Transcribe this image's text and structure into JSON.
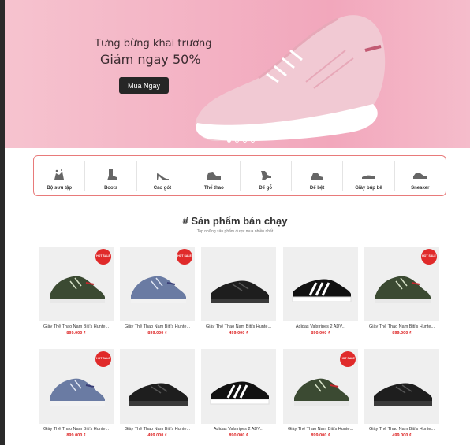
{
  "banner": {
    "line1": "Tưng bừng khai trương",
    "line2": "Giảm ngay 50%",
    "button": "Mua Ngay",
    "slides": 4,
    "active_slide": 1
  },
  "categories": [
    {
      "label": "Bộ sưu tập",
      "icon": "collection-icon"
    },
    {
      "label": "Boots",
      "icon": "boot-icon"
    },
    {
      "label": "Cao gót",
      "icon": "high-heel-icon"
    },
    {
      "label": "Thể thao",
      "icon": "sneaker-icon"
    },
    {
      "label": "Đế gỗ",
      "icon": "wooden-sole-icon"
    },
    {
      "label": "Đế bệt",
      "icon": "flat-shoe-icon"
    },
    {
      "label": "Giày búp bê",
      "icon": "ballet-flat-icon"
    },
    {
      "label": "Sneaker",
      "icon": "sneaker-icon"
    }
  ],
  "section": {
    "title": "# Sản phẩm bán chạy",
    "subtitle": "Top những sản phẩm được mua nhiều nhất"
  },
  "products": [
    {
      "name": "Giày Thể Thao Nam Biti's Hunte...",
      "price": "899.000 ₫",
      "badge": true,
      "color": "green"
    },
    {
      "name": "Giày Thể Thao Nam Biti's Hunte...",
      "price": "899.000 ₫",
      "badge": true,
      "color": "blue"
    },
    {
      "name": "Giày Thể Thao Nam Biti's Hunte...",
      "price": "499.000 ₫",
      "badge": false,
      "color": "black"
    },
    {
      "name": "Adidas Valstripes 2 ADV...",
      "price": "890.000 ₫",
      "badge": false,
      "color": "adidas"
    },
    {
      "name": "Giày Thể Thao Nam Biti's Hunte...",
      "price": "899.000 ₫",
      "badge": true,
      "color": "green"
    },
    {
      "name": "Giày Thể Thao Nam Biti's Hunte...",
      "price": "899.000 ₫",
      "badge": true,
      "color": "blue"
    },
    {
      "name": "Giày Thể Thao Nam Biti's Hunte...",
      "price": "499.000 ₫",
      "badge": false,
      "color": "black"
    },
    {
      "name": "Adidas Valstripes 2 ADV...",
      "price": "890.000 ₫",
      "badge": false,
      "color": "adidas"
    },
    {
      "name": "Giày Thể Thao Nam Biti's Hunte...",
      "price": "899.000 ₫",
      "badge": true,
      "color": "green"
    },
    {
      "name": "Giày Thể Thao Nam Biti's Hunte...",
      "price": "499.000 ₫",
      "badge": false,
      "color": "black"
    }
  ],
  "badge_text": "HOT SALE",
  "colors": {
    "accent": "#e02a2a",
    "border": "#e87a7a",
    "banner": "#f3b1c3"
  }
}
